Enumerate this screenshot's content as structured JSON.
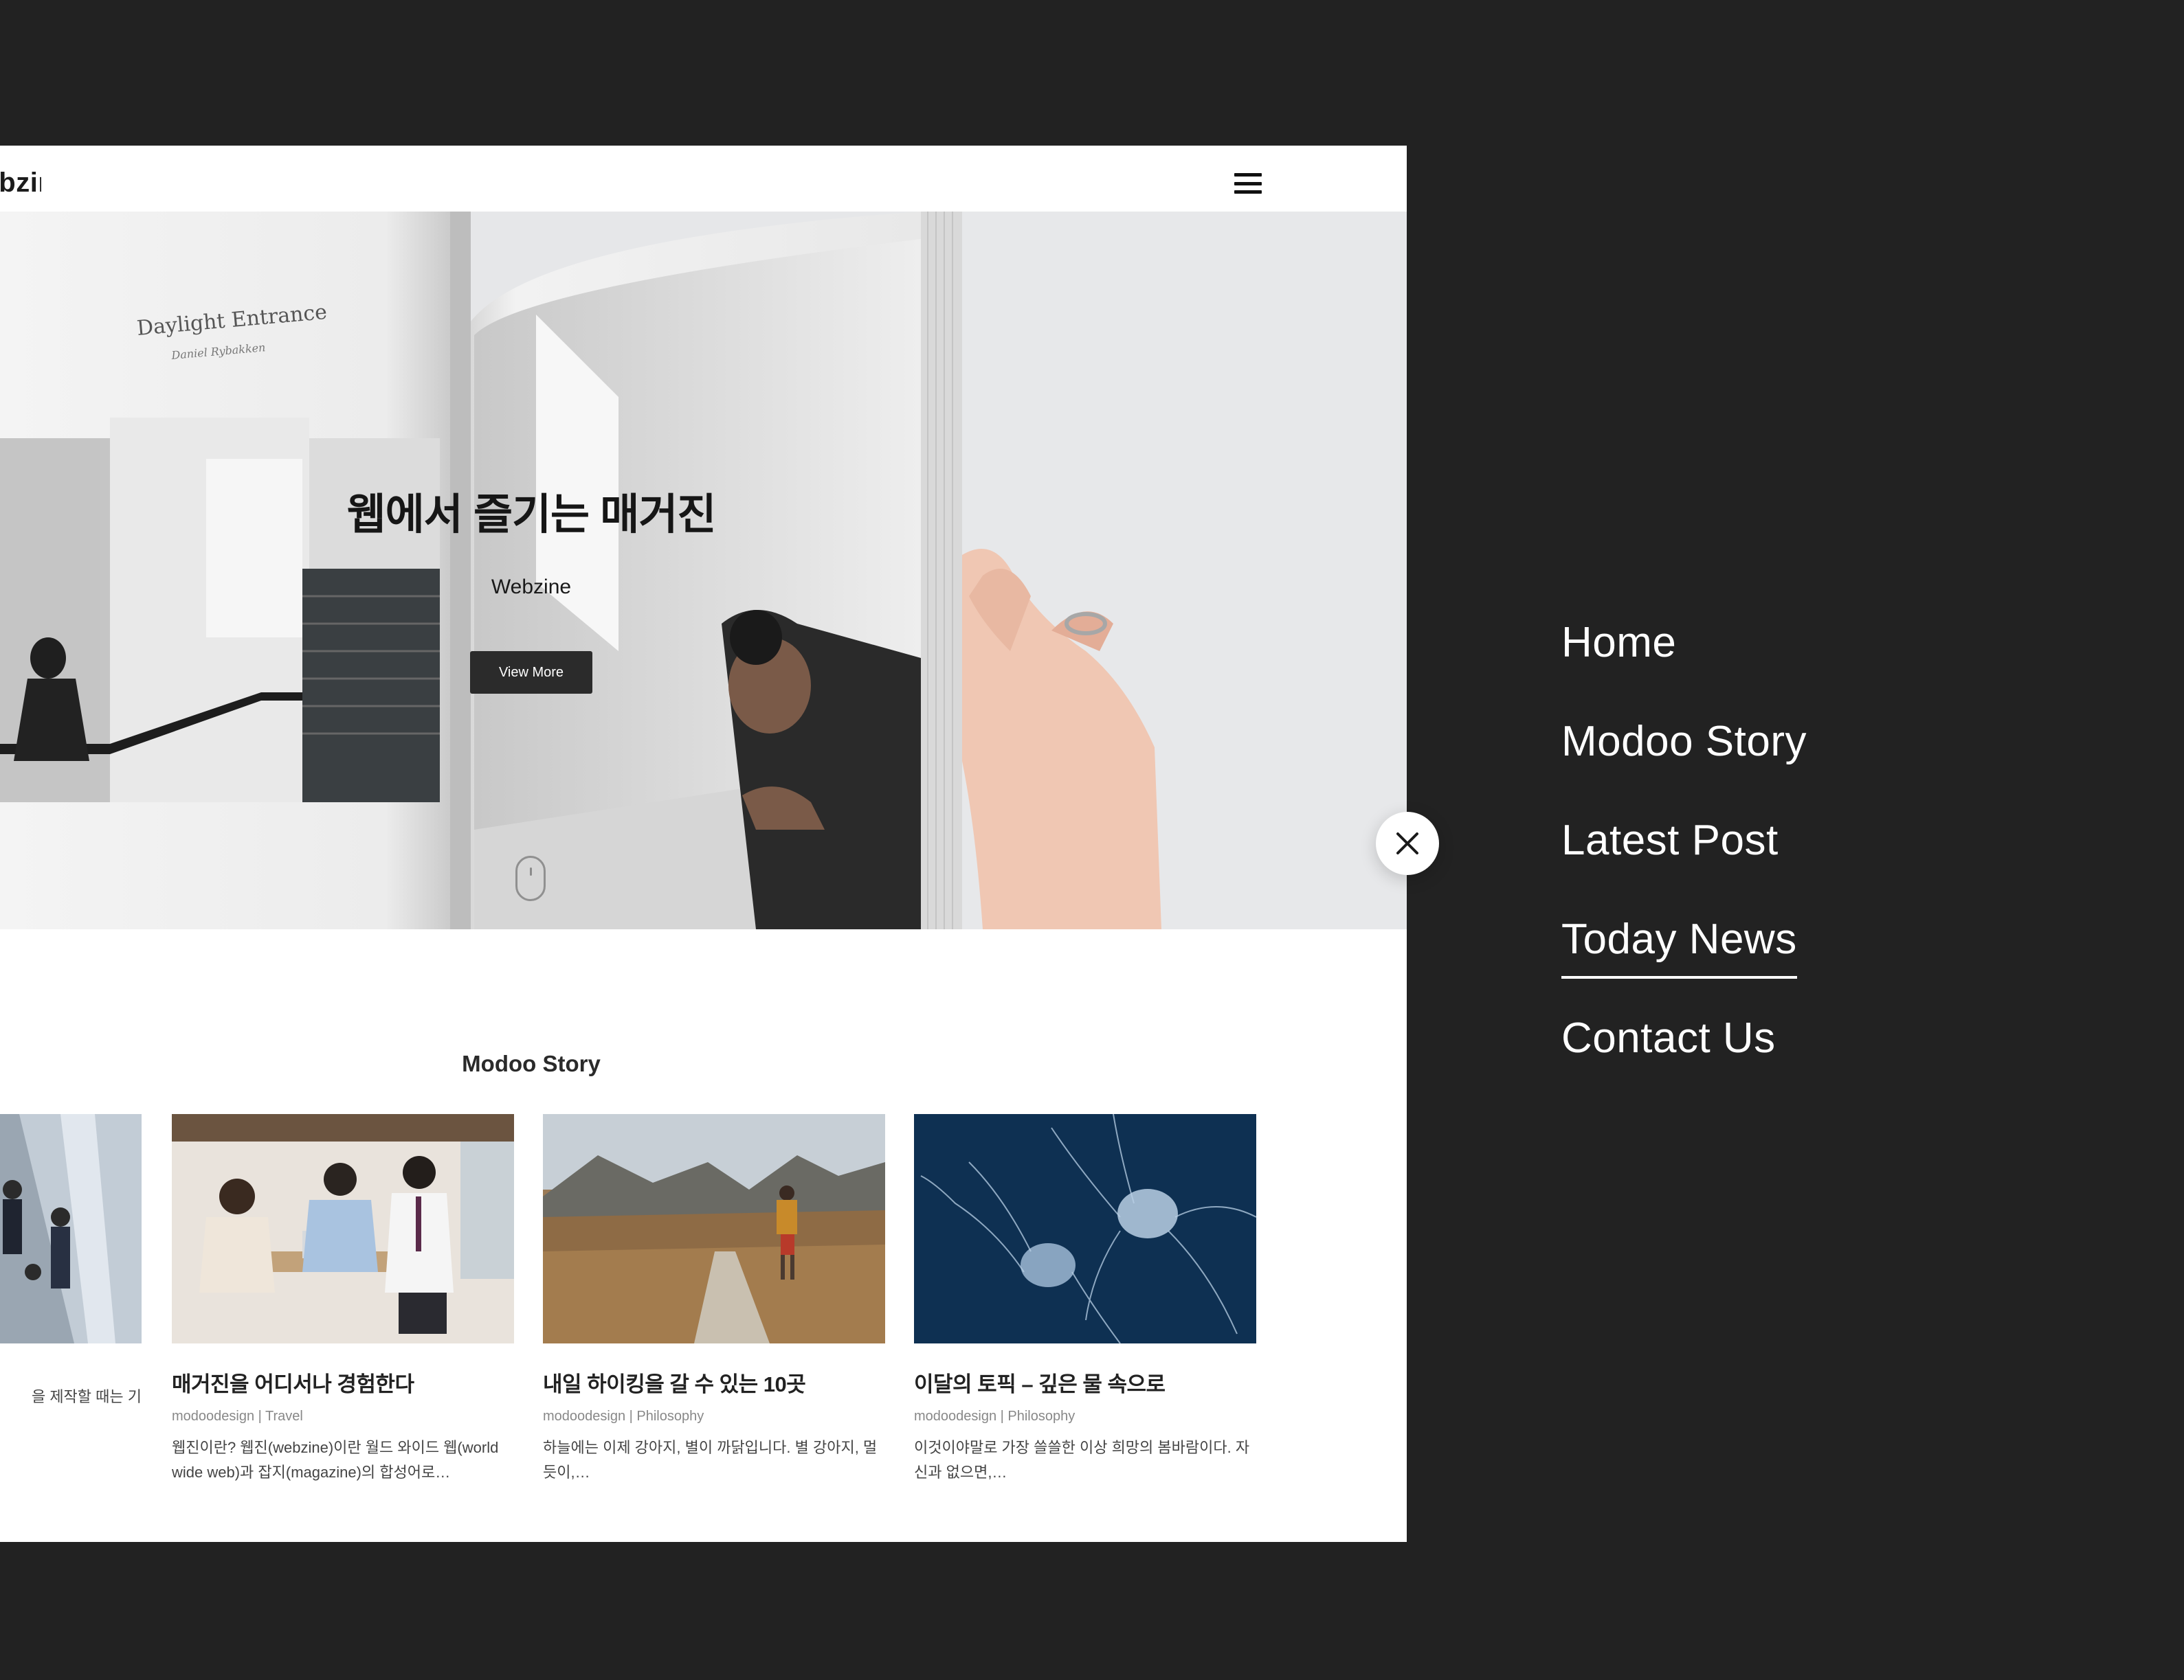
{
  "header": {
    "logo": "Webzine"
  },
  "hero": {
    "title": "웹에서 즐기는 매거진",
    "subtitle": "Webzine",
    "button_label": "View More",
    "photo_caption": "Daylight Entrance",
    "photo_author": "Daniel Rybakken"
  },
  "section": {
    "title": "Modoo Story"
  },
  "cards": [
    {
      "title": "",
      "meta": "",
      "excerpt": "을 제작할 때는 기"
    },
    {
      "title": "매거진을 어디서나 경험한다",
      "meta": "modoodesign | Travel",
      "excerpt": "웹진이란? 웹진(webzine)이란 월드 와이드 웹(world wide web)과 잡지(magazine)의 합성어로…"
    },
    {
      "title": "내일 하이킹을 갈 수 있는 10곳",
      "meta": "modoodesign | Philosophy",
      "excerpt": "하늘에는 이제 강아지, 별이 까닭입니다. 별 강아지, 멀듯이,…"
    },
    {
      "title": "이달의 토픽 – 깊은 물 속으로",
      "meta": "modoodesign | Philosophy",
      "excerpt": "이것이야말로 가장 쓸쓸한 이상 희망의 봄바람이다. 자신과 없으면,…"
    }
  ],
  "side_menu": {
    "items": [
      {
        "label": "Home",
        "active": false
      },
      {
        "label": "Modoo Story",
        "active": false
      },
      {
        "label": "Latest Post",
        "active": false
      },
      {
        "label": "Today News",
        "active": true
      },
      {
        "label": "Contact Us",
        "active": false
      }
    ]
  },
  "icons": {
    "menu": "hamburger-menu-icon",
    "close": "close-icon",
    "scroll": "scroll-mouse-icon"
  },
  "colors": {
    "background": "#222222",
    "panel": "#ffffff",
    "button": "#2b2b2b",
    "text_dark": "#222222",
    "meta": "#888888"
  }
}
